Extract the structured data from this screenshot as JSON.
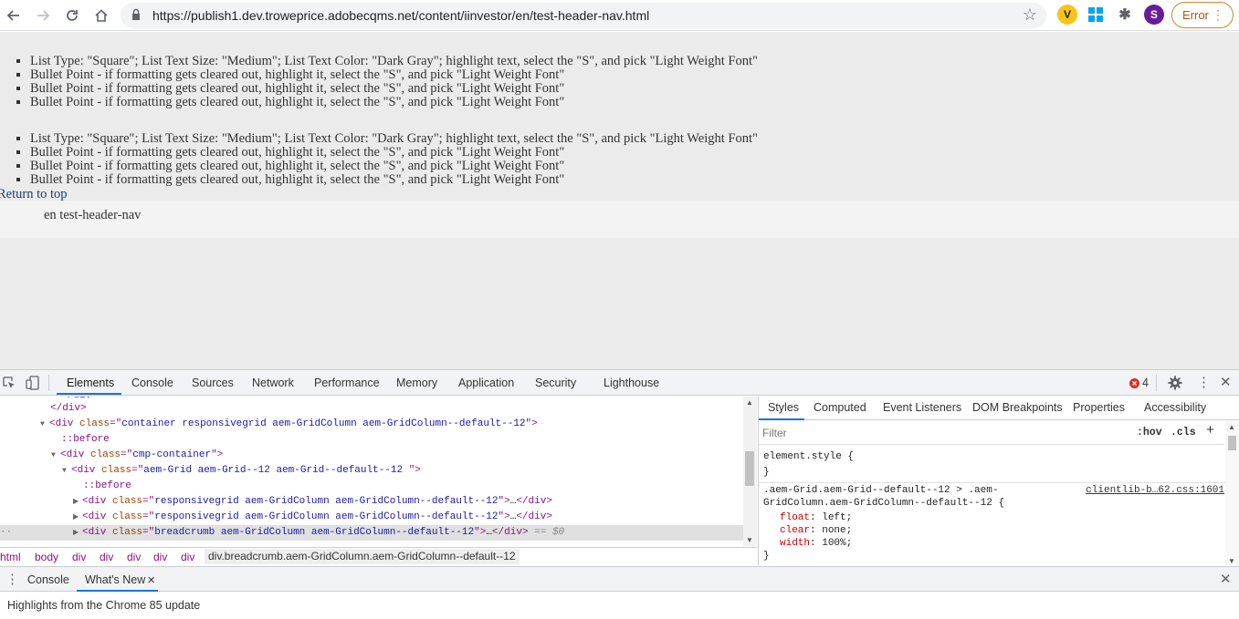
{
  "browser": {
    "url": "https://publish1.dev.troweprice.adobecqms.net/content/iinvestor/en/test-header-nav.html",
    "profile_initial": "S",
    "error_label": "Error"
  },
  "page": {
    "list1": [
      "List Type: \"Square\"; List Text Size: \"Medium\"; List Text Color: \"Dark Gray\"; highlight text, select the \"S\", and pick \"Light Weight Font\"",
      "Bullet Point - if formatting gets cleared out, highlight it, select the \"S\", and pick \"Light Weight Font\"",
      "Bullet Point - if formatting gets cleared out, highlight it, select the \"S\", and pick \"Light Weight Font\"",
      "Bullet Point - if formatting gets cleared out, highlight it, select the \"S\", and pick \"Light Weight Font\""
    ],
    "list2": [
      "List Type: \"Square\"; List Text Size: \"Medium\"; List Text Color: \"Dark Gray\"; highlight text, select the \"S\", and pick \"Light Weight Font\"",
      "Bullet Point - if formatting gets cleared out, highlight it, select the \"S\", and pick \"Light Weight Font\"",
      "Bullet Point - if formatting gets cleared out, highlight it, select the \"S\", and pick \"Light Weight Font\"",
      "Bullet Point - if formatting gets cleared out, highlight it, select the \"S\", and pick \"Light Weight Font\""
    ],
    "return_to_top": "Return to top",
    "breadcrumb_text": "en test-header-nav"
  },
  "devtools": {
    "tabs": [
      "Elements",
      "Console",
      "Sources",
      "Network",
      "Performance",
      "Memory",
      "Application",
      "Security",
      "Lighthouse"
    ],
    "error_count": "4",
    "dom": {
      "l0": "</div>",
      "l1_class": "container responsivegrid aem-GridColumn aem-GridColumn--default--12",
      "l2": "::before",
      "l3_class": "cmp-container",
      "l4_class": "aem-Grid aem-Grid--12 aem-Grid--default--12 ",
      "l5": "::before",
      "l6_class": "responsivegrid aem-GridColumn aem-GridColumn--default--12",
      "l7_class": "responsivegrid aem-GridColumn aem-GridColumn--default--12",
      "l8_class": "breadcrumb aem-GridColumn aem-GridColumn--default--12",
      "l8_suffix": "== $0",
      "tag_div": "div",
      "attr_class": "class",
      "ellipsis": "…"
    },
    "crumbs": [
      "html",
      "body",
      "div",
      "div",
      "div",
      "div",
      "div"
    ],
    "crumb_current": "div.breadcrumb.aem-GridColumn.aem-GridColumn--default--12",
    "styles_tabs": [
      "Styles",
      "Computed",
      "Event Listeners",
      "DOM Breakpoints",
      "Properties",
      "Accessibility"
    ],
    "filter_placeholder": "Filter",
    "filter_hov": ":hov",
    "filter_cls": ".cls",
    "filter_add": "+",
    "rule1_selector": "element.style {",
    "rule_close": "}",
    "rule2_selector_a": ".aem-Grid.aem-Grid--default--12 > .aem-",
    "rule2_selector_b": "GridColumn.aem-GridColumn--default--12 {",
    "rule2_source": "clientlib-b…62.css:1601",
    "rule2_props": [
      {
        "name": "float",
        "value": "left;"
      },
      {
        "name": "clear",
        "value": "none;"
      },
      {
        "name": "width",
        "value": "100%;"
      }
    ],
    "drawer_tabs": [
      "Console",
      "What's New"
    ],
    "drawer_message": "Highlights from the Chrome 85 update"
  },
  "colors": {
    "accent": "#1a73e8",
    "page_bg": "#ebebeb",
    "error_chip": "#d9822b",
    "profile": "#6a1b9a"
  }
}
